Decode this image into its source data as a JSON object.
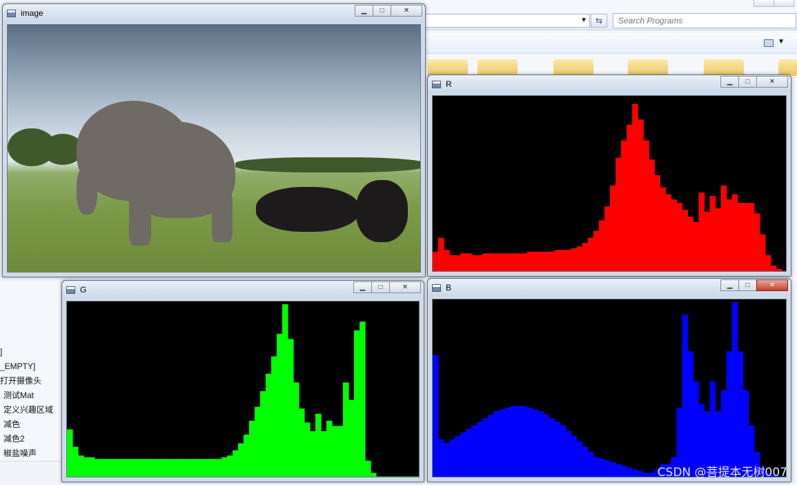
{
  "background": {
    "search_placeholder": "Search Programs",
    "left_list": [
      "]",
      "_EMPTY]",
      "打开摄像头",
      "测试Mat",
      "定义兴趣区域",
      "减色",
      "减色2",
      "椒盐噪声"
    ]
  },
  "windows": {
    "image": {
      "title": "image"
    },
    "r": {
      "title": "R",
      "color": "#ff0000"
    },
    "g": {
      "title": "G",
      "color": "#00ff00"
    },
    "b": {
      "title": "B",
      "color": "#0000ff"
    }
  },
  "icons": {
    "minimize": "minimize-icon",
    "maximize": "maximize-icon",
    "close": "close-icon"
  },
  "watermark": "CSDN @菩提本无树007",
  "chart_data": [
    {
      "type": "area",
      "series": [
        {
          "color": "#ff0000",
          "values": [
            0.12,
            0.2,
            0.13,
            0.1,
            0.1,
            0.11,
            0.11,
            0.1,
            0.1,
            0.11,
            0.11,
            0.11,
            0.11,
            0.11,
            0.11,
            0.11,
            0.11,
            0.12,
            0.12,
            0.12,
            0.12,
            0.12,
            0.13,
            0.13,
            0.13,
            0.14,
            0.15,
            0.17,
            0.2,
            0.24,
            0.3,
            0.38,
            0.5,
            0.66,
            0.76,
            0.85,
            0.97,
            0.88,
            0.76,
            0.65,
            0.56,
            0.49,
            0.45,
            0.42,
            0.4,
            0.36,
            0.32,
            0.29,
            0.46,
            0.35,
            0.44,
            0.37,
            0.5,
            0.42,
            0.45,
            0.4,
            0.4,
            0.4,
            0.34,
            0.22,
            0.1,
            0.04,
            0.02,
            0.01
          ]
        }
      ],
      "xlim": [
        0,
        255
      ]
    },
    {
      "type": "area",
      "series": [
        {
          "color": "#00ff00",
          "values": [
            0.28,
            0.18,
            0.13,
            0.12,
            0.12,
            0.11,
            0.11,
            0.11,
            0.11,
            0.11,
            0.11,
            0.11,
            0.11,
            0.11,
            0.11,
            0.11,
            0.11,
            0.11,
            0.11,
            0.11,
            0.11,
            0.11,
            0.11,
            0.11,
            0.11,
            0.11,
            0.11,
            0.11,
            0.12,
            0.13,
            0.16,
            0.2,
            0.25,
            0.33,
            0.41,
            0.5,
            0.6,
            0.7,
            0.83,
            1.0,
            0.8,
            0.55,
            0.4,
            0.32,
            0.27,
            0.37,
            0.27,
            0.33,
            0.3,
            0.3,
            0.55,
            0.45,
            0.85,
            0.9,
            0.1,
            0.03,
            0.01,
            0.01,
            0.01,
            0.01,
            0.01,
            0.01,
            0.01,
            0.01
          ]
        }
      ],
      "xlim": [
        0,
        255
      ]
    },
    {
      "type": "area",
      "series": [
        {
          "color": "#0000ff",
          "values": [
            0.7,
            0.22,
            0.2,
            0.22,
            0.24,
            0.26,
            0.28,
            0.3,
            0.32,
            0.34,
            0.36,
            0.38,
            0.39,
            0.4,
            0.41,
            0.41,
            0.41,
            0.4,
            0.39,
            0.38,
            0.36,
            0.34,
            0.32,
            0.3,
            0.27,
            0.24,
            0.21,
            0.18,
            0.15,
            0.12,
            0.11,
            0.1,
            0.09,
            0.08,
            0.07,
            0.06,
            0.05,
            0.04,
            0.03,
            0.03,
            0.05,
            0.08,
            0.08,
            0.12,
            0.4,
            0.93,
            0.72,
            0.55,
            0.42,
            0.38,
            0.55,
            0.38,
            0.5,
            0.72,
            1.0,
            0.72,
            0.5,
            0.3,
            0.15,
            0.06,
            0.03,
            0.02,
            0.01,
            0.01
          ]
        }
      ],
      "xlim": [
        0,
        255
      ]
    }
  ]
}
